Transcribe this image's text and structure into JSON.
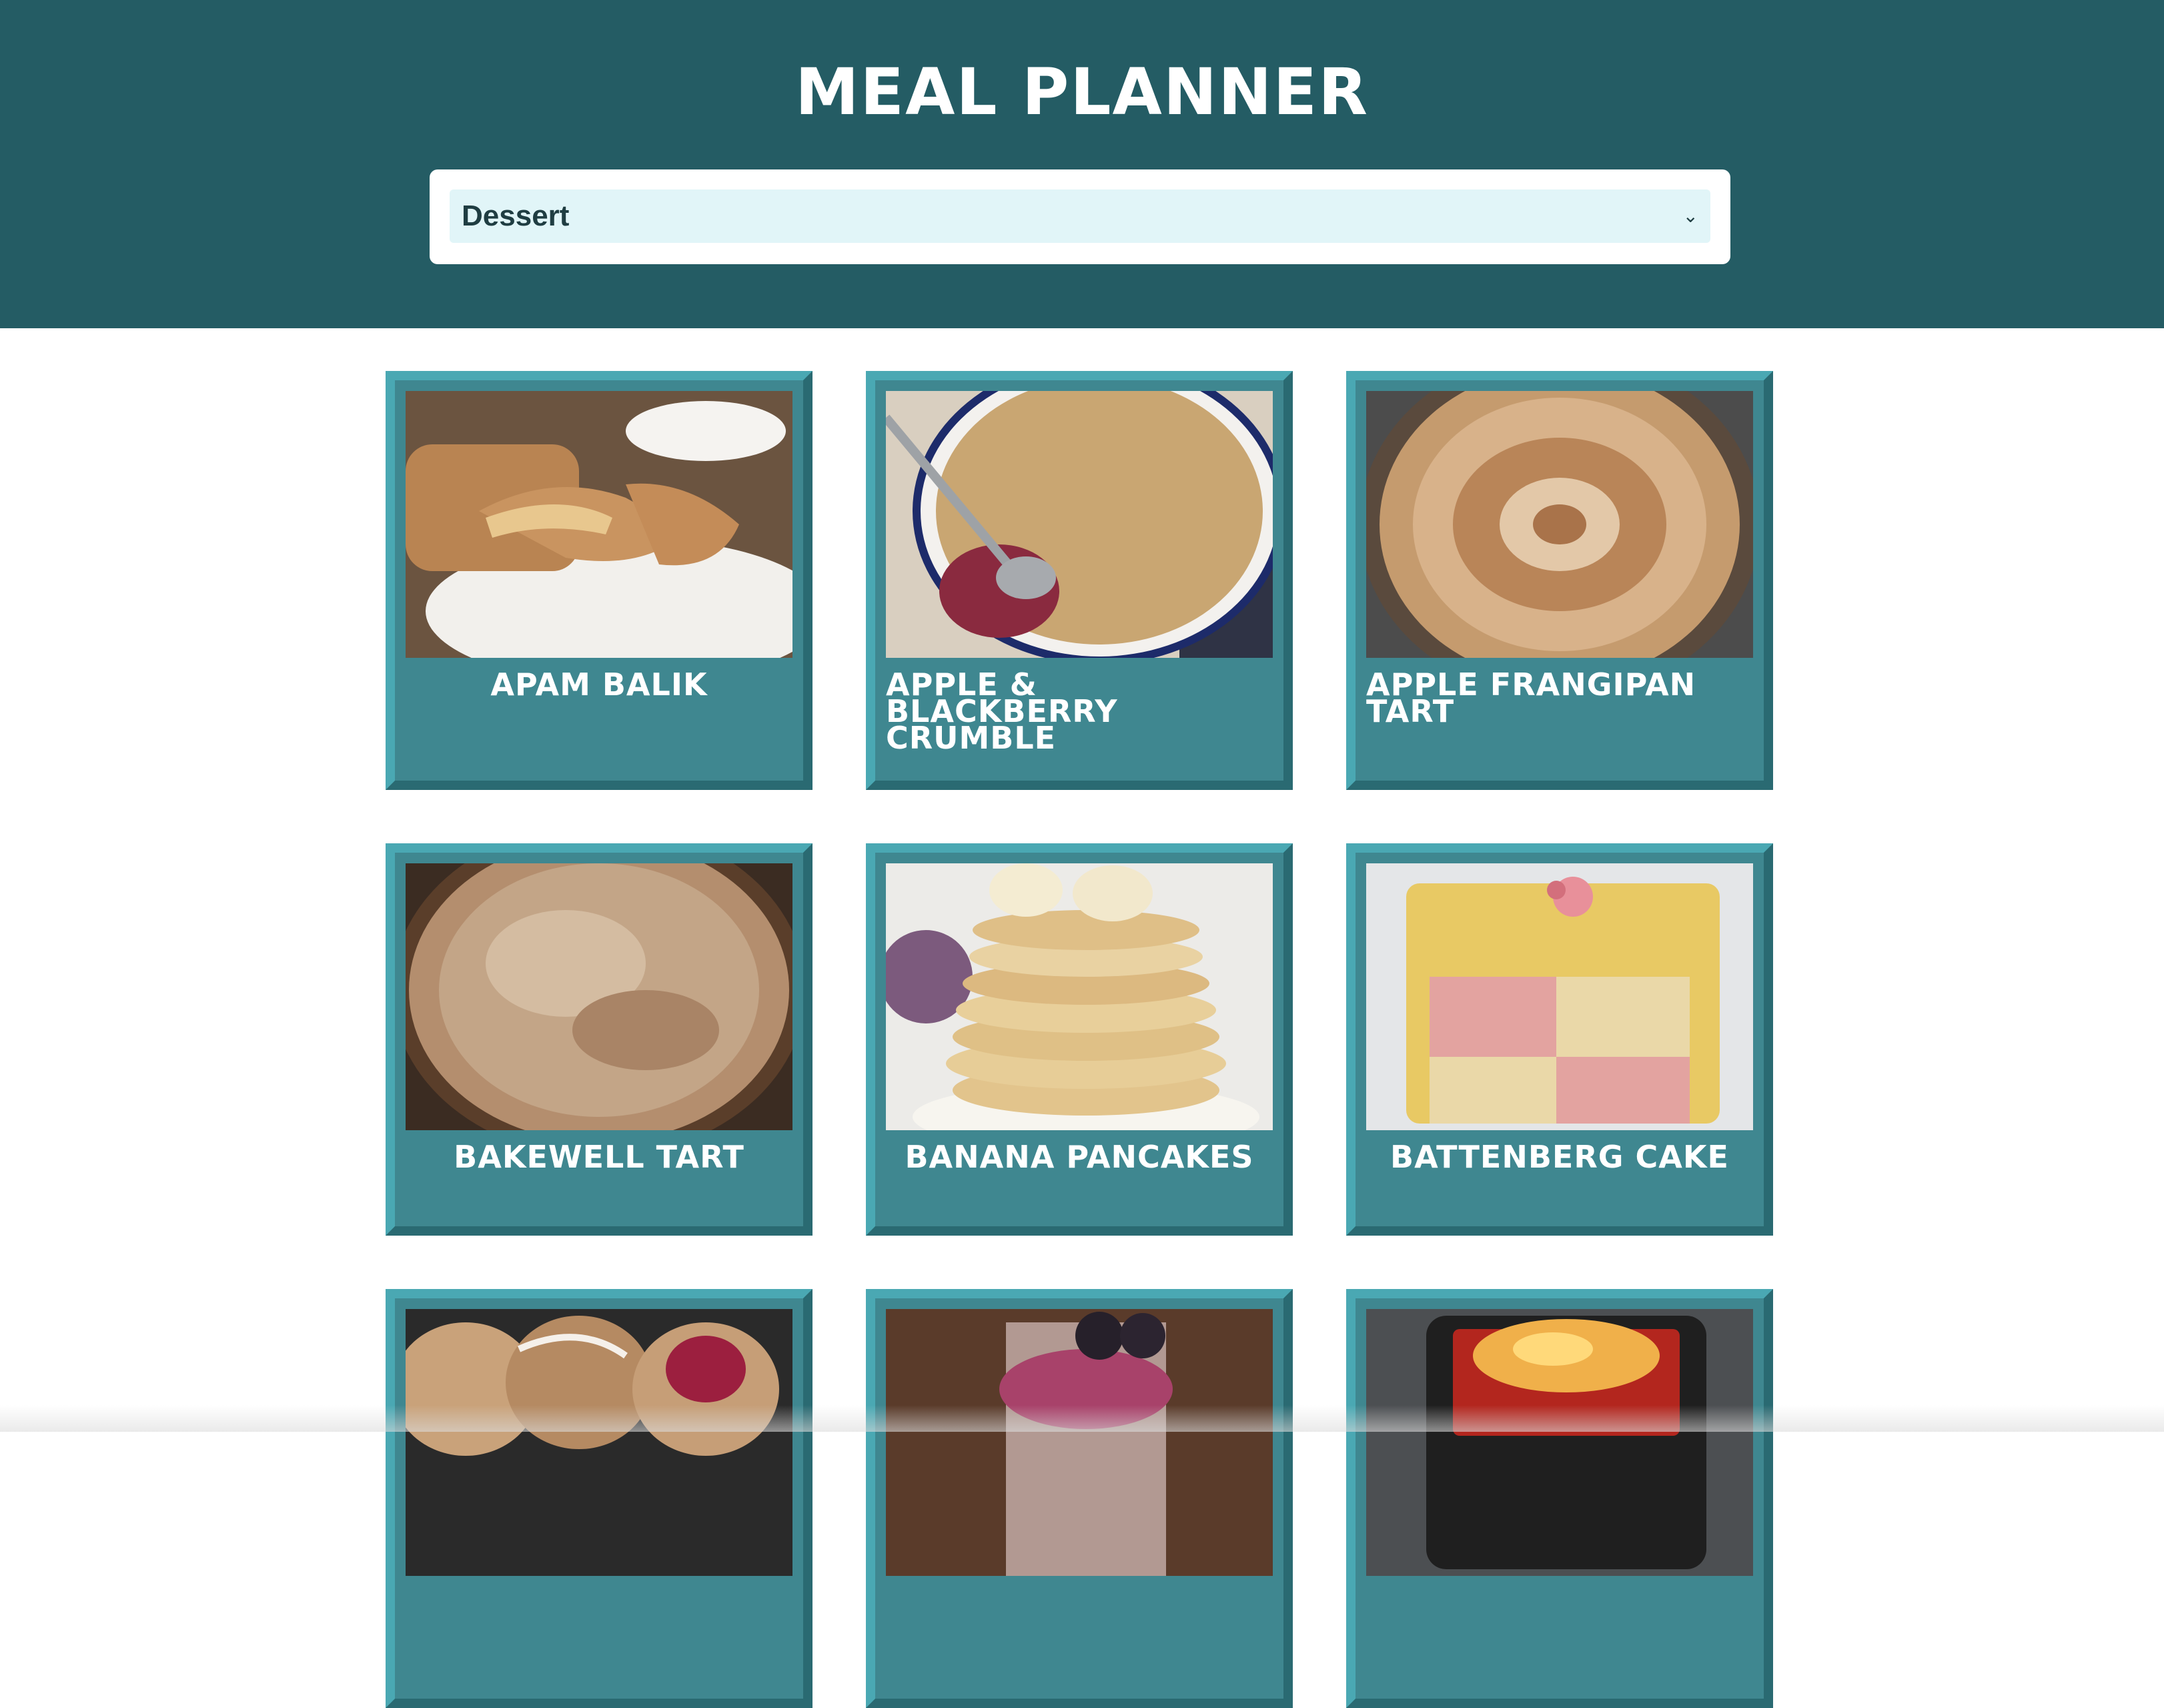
{
  "header": {
    "title": "Meal Planner",
    "background": "#245c64"
  },
  "category_select": {
    "value": "Dessert",
    "icon": "chevron-down-icon"
  },
  "meals": [
    {
      "name": "Apam Balik"
    },
    {
      "name": "Apple & Blackberry Crumble"
    },
    {
      "name": "Apple Frangipan Tart"
    },
    {
      "name": "Bakewell Tart"
    },
    {
      "name": "Banana Pancakes"
    },
    {
      "name": "Battenberg Cake"
    },
    {
      "name": ""
    },
    {
      "name": ""
    },
    {
      "name": ""
    }
  ],
  "colors": {
    "card": "#3f8790",
    "card_light_edge": "#4aa8b3",
    "card_dark_edge": "#2a6a72",
    "select_bg": "#e1f5f8"
  }
}
